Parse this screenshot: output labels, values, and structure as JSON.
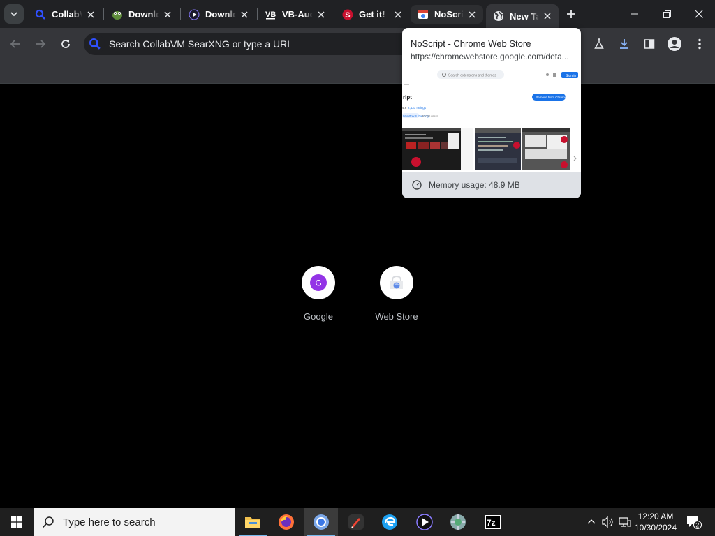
{
  "tabs": [
    {
      "title": "CollabVM",
      "favicon": "searxng-icon",
      "active": false
    },
    {
      "title": "Download",
      "favicon": "frog-icon",
      "active": false
    },
    {
      "title": "Download",
      "favicon": "play-shield-icon",
      "active": false
    },
    {
      "title": "VB-Audio",
      "favicon": "vb-audio-icon",
      "active": false
    },
    {
      "title": "Get it!",
      "favicon": "noscript-icon",
      "active": false
    },
    {
      "title": "NoScript",
      "favicon": "webstore-icon",
      "active": false,
      "hovered": true
    },
    {
      "title": "New Tab",
      "favicon": "globe-icon",
      "active": true
    }
  ],
  "omnibox": {
    "placeholder": "Search CollabVM SearXNG or type a URL"
  },
  "hover_card": {
    "title": "NoScript - Chrome Web Store",
    "url": "https://chromewebstore.google.com/deta...",
    "memory": "Memory usage: 48.9 MB"
  },
  "thumbnail": {
    "search_placeholder": "Search extensions and themes",
    "signin": "Sign in",
    "heading": "ript",
    "button": "Remove from Chrome",
    "rating": "4.6",
    "ratings_link": "2,431 ratings",
    "chip1": "Workflow & Planning",
    "chip2": "30,000 users"
  },
  "shortcuts": [
    {
      "label": "Google",
      "letter": "G"
    },
    {
      "label": "Web Store"
    }
  ],
  "taskbar": {
    "search_placeholder": "Type here to search",
    "time": "12:20 AM",
    "date": "10/30/2024",
    "notification_count": "2"
  },
  "colors": {
    "tabstrip": "#202124",
    "toolbar": "#35363a",
    "accent_blue": "#8ab4f8",
    "taskbar": "#1f1f1f"
  }
}
